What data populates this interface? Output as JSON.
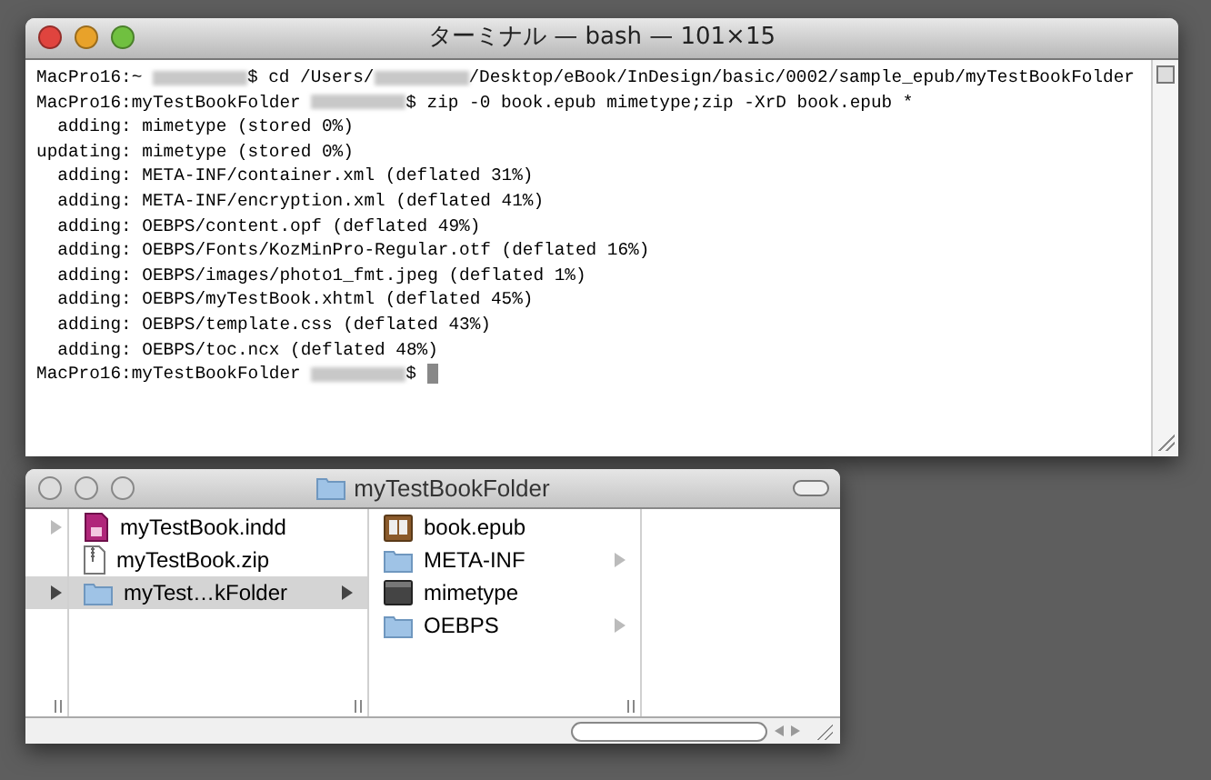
{
  "terminal": {
    "title": "ターミナル — bash — 101×15",
    "lines": [
      {
        "segments": [
          {
            "kind": "text",
            "text": "MacPro16:~ "
          },
          {
            "kind": "redacted"
          },
          {
            "kind": "text",
            "text": "$ cd /Users/"
          },
          {
            "kind": "redacted"
          },
          {
            "kind": "text",
            "text": "/Desktop/eBook/InDesign/basic/0002/sample_epub/myTestBookFolder"
          }
        ]
      },
      {
        "segments": [
          {
            "kind": "text",
            "text": "MacPro16:myTestBookFolder "
          },
          {
            "kind": "redacted"
          },
          {
            "kind": "text",
            "text": "$ zip -0 book.epub mimetype;zip -XrD book.epub *"
          }
        ]
      },
      {
        "segments": [
          {
            "kind": "text",
            "text": "  adding: mimetype (stored 0%)"
          }
        ]
      },
      {
        "segments": [
          {
            "kind": "text",
            "text": "updating: mimetype (stored 0%)"
          }
        ]
      },
      {
        "segments": [
          {
            "kind": "text",
            "text": "  adding: META-INF/container.xml (deflated 31%)"
          }
        ]
      },
      {
        "segments": [
          {
            "kind": "text",
            "text": "  adding: META-INF/encryption.xml (deflated 41%)"
          }
        ]
      },
      {
        "segments": [
          {
            "kind": "text",
            "text": "  adding: OEBPS/content.opf (deflated 49%)"
          }
        ]
      },
      {
        "segments": [
          {
            "kind": "text",
            "text": "  adding: OEBPS/Fonts/KozMinPro-Regular.otf (deflated 16%)"
          }
        ]
      },
      {
        "segments": [
          {
            "kind": "text",
            "text": "  adding: OEBPS/images/photo1_fmt.jpeg (deflated 1%)"
          }
        ]
      },
      {
        "segments": [
          {
            "kind": "text",
            "text": "  adding: OEBPS/myTestBook.xhtml (deflated 45%)"
          }
        ]
      },
      {
        "segments": [
          {
            "kind": "text",
            "text": "  adding: OEBPS/template.css (deflated 43%)"
          }
        ]
      },
      {
        "segments": [
          {
            "kind": "text",
            "text": "  adding: OEBPS/toc.ncx (deflated 48%)"
          }
        ]
      },
      {
        "segments": [
          {
            "kind": "text",
            "text": "MacPro16:myTestBookFolder "
          },
          {
            "kind": "redacted"
          },
          {
            "kind": "text",
            "text": "$ "
          },
          {
            "kind": "cursor"
          }
        ]
      }
    ]
  },
  "finder": {
    "title": "myTestBookFolder",
    "columns": [
      {
        "items": [
          {
            "kind": "blank",
            "selected": false,
            "has_children": true
          },
          {
            "kind": "spacer"
          },
          {
            "kind": "blank",
            "selected": true,
            "has_children": true
          }
        ]
      },
      {
        "items": [
          {
            "kind": "indd",
            "name": "myTestBook.indd",
            "selected": false,
            "has_children": false
          },
          {
            "kind": "zip",
            "name": "myTestBook.zip",
            "selected": false,
            "has_children": false
          },
          {
            "kind": "folder",
            "name": "myTest…kFolder",
            "selected": true,
            "has_children": true
          }
        ]
      },
      {
        "items": [
          {
            "kind": "epub",
            "name": "book.epub",
            "selected": false,
            "has_children": false
          },
          {
            "kind": "folder",
            "name": "META-INF",
            "selected": false,
            "has_children": true
          },
          {
            "kind": "file",
            "name": "mimetype",
            "selected": false,
            "has_children": false
          },
          {
            "kind": "folder",
            "name": "OEBPS",
            "selected": false,
            "has_children": true
          }
        ]
      }
    ]
  }
}
